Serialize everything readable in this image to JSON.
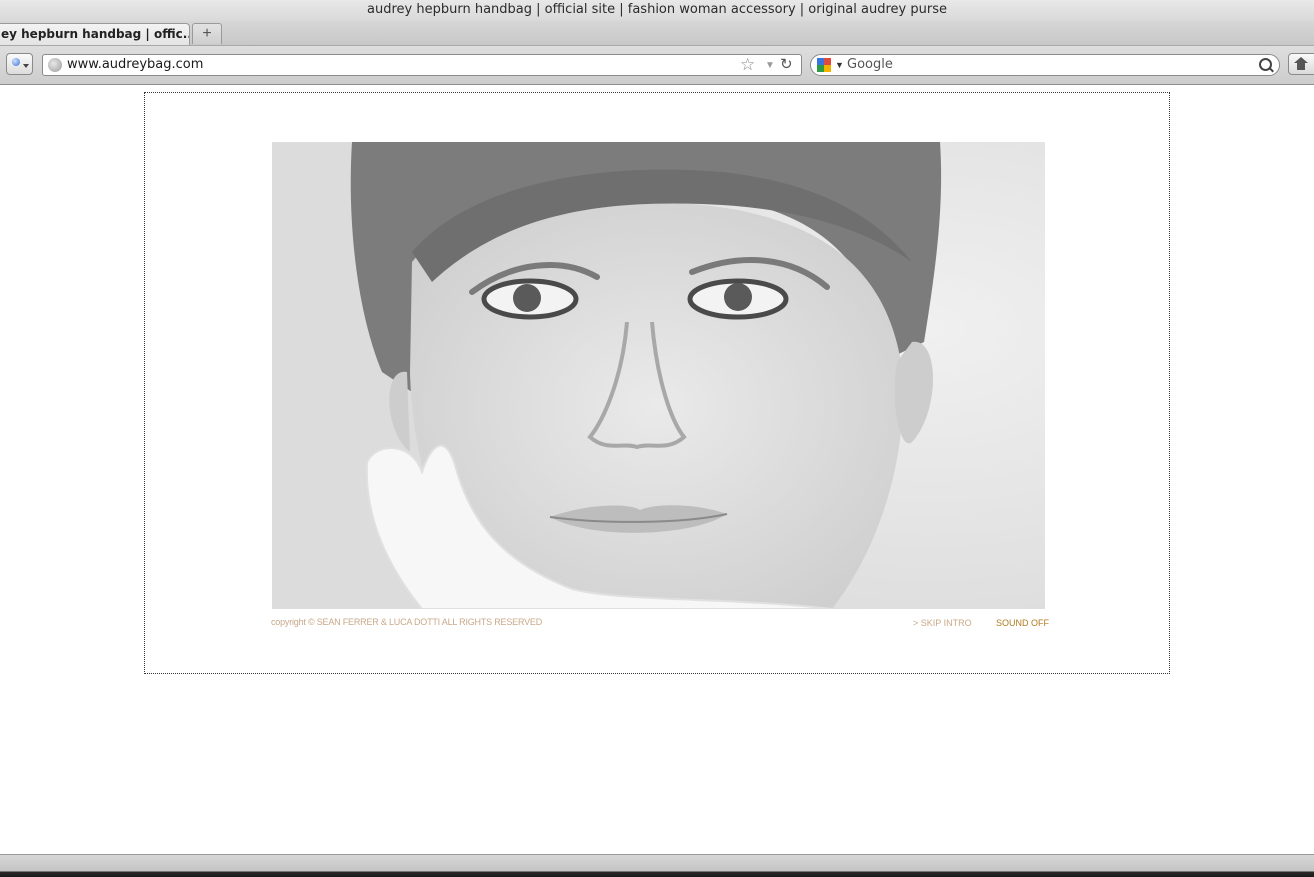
{
  "window": {
    "title": "audrey hepburn handbag | official site | fashion woman accessory | original audrey purse"
  },
  "tabs": [
    {
      "label": "ey hepburn handbag | offic..."
    }
  ],
  "new_tab_label": "+",
  "navbar": {
    "url": "www.audreybag.com",
    "search_placeholder": "Google"
  },
  "page": {
    "photo_subject": "Audrey Hepburn portrait",
    "copyright": "copyright © SEAN FERRER & LUCA DOTTI ALL RIGHTS RESERVED",
    "skip_intro": "> SKIP INTRO",
    "sound_off": "SOUND OFF"
  },
  "colors": {
    "footer_text": "#c8a888",
    "sound_accent": "#b07a20"
  }
}
